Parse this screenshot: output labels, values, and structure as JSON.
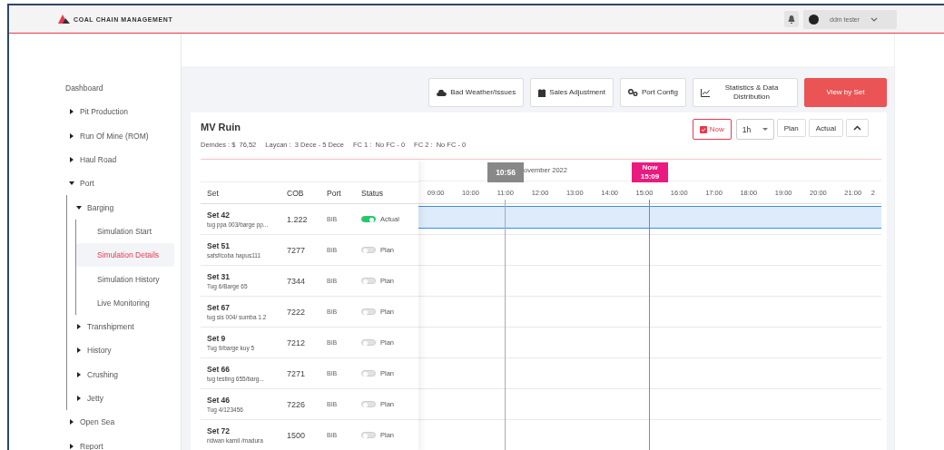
{
  "header": {
    "logo": "COAL CHAIN MANAGEMENT",
    "user": "ddm tester"
  },
  "sidebar": {
    "items": [
      {
        "label": "Dashboard",
        "selected": false
      },
      {
        "label": "Pit Production",
        "selected": false,
        "expanded": false
      },
      {
        "label": "Run Of Mine (ROM)",
        "selected": false,
        "expanded": false
      },
      {
        "label": "Haul Road",
        "selected": false,
        "expanded": false
      },
      {
        "label": "Port",
        "selected": false,
        "expanded": true,
        "children": [
          {
            "label": "Barging",
            "selected": false,
            "expanded": true,
            "children": [
              {
                "label": "Simulation Start",
                "selected": false
              },
              {
                "label": "Simulation Details",
                "selected": true
              },
              {
                "label": "Simulation History",
                "selected": false
              },
              {
                "label": "Live Monitoring",
                "selected": false
              }
            ]
          },
          {
            "label": "Transhipment",
            "selected": false,
            "expanded": false
          },
          {
            "label": "History",
            "selected": false,
            "expanded": false
          },
          {
            "label": "Crushing",
            "selected": false,
            "expanded": false
          },
          {
            "label": "Jetty",
            "selected": false,
            "expanded": false
          }
        ]
      },
      {
        "label": "Open Sea",
        "selected": false,
        "expanded": false
      },
      {
        "label": "Report",
        "selected": false,
        "expanded": false
      }
    ]
  },
  "toolbar": [
    {
      "label": "Bad Weather/Issues",
      "kind": "cloud"
    },
    {
      "label": "Sales Adjustment",
      "kind": "calendar"
    },
    {
      "label": "Port Config",
      "kind": "gears"
    },
    {
      "label": "Statistics & Data Distribution",
      "kind": "chart"
    },
    {
      "label": "View by Set",
      "kind": "primary"
    }
  ],
  "vessel": {
    "title": "MV Ruin",
    "info": [
      "Demdes : $  76,52",
      "Laycan :  3 Dece - 5 Dece",
      "FC 1 :  No FC - 0",
      "FC 2 :  No FC - 0"
    ]
  },
  "controls": {
    "now": "Now",
    "interval": "1h",
    "plan": "Plan",
    "actual": "Actual"
  },
  "timeline": {
    "date": "ovember 2022",
    "cursor": "10:56",
    "now_label": "Now",
    "now_time": "15:09",
    "hours": [
      "09:00",
      "10:00",
      "11:00",
      "12:00",
      "13:00",
      "14:00",
      "15:00",
      "16:00",
      "17:00",
      "18:00",
      "19:00",
      "20:00",
      "21:00",
      "2"
    ]
  },
  "table": {
    "columns": [
      "Set",
      "COB",
      "Port",
      "Status"
    ],
    "rows": [
      {
        "set": "Set 42",
        "sub": "tug ppa 003/barge pp...",
        "cob": "1.222",
        "port": "BIB",
        "on": true,
        "status": "Actual",
        "selected": true
      },
      {
        "set": "Set 51",
        "sub": "safsf/coba hapus111",
        "cob": "7277",
        "port": "BIB",
        "on": false,
        "status": "Plan",
        "selected": false
      },
      {
        "set": "Set 31",
        "sub": "Tug 6/Barge 65",
        "cob": "7344",
        "port": "BIB",
        "on": false,
        "status": "Plan",
        "selected": false
      },
      {
        "set": "Set 67",
        "sub": "tug sis 004/ sumba 1.2",
        "cob": "7222",
        "port": "BIB",
        "on": false,
        "status": "Plan",
        "selected": false
      },
      {
        "set": "Set 9",
        "sub": "Tug 9/barge kuy 5",
        "cob": "7212",
        "port": "BIB",
        "on": false,
        "status": "Plan",
        "selected": false
      },
      {
        "set": "Set 66",
        "sub": "tug testing 655/barg...",
        "cob": "7271",
        "port": "BIB",
        "on": false,
        "status": "Plan",
        "selected": false
      },
      {
        "set": "Set 46",
        "sub": "Tug 4/123456",
        "cob": "7226",
        "port": "BIB",
        "on": false,
        "status": "Plan",
        "selected": false
      },
      {
        "set": "Set 72",
        "sub": "ridwan kamil /madura",
        "cob": "1500",
        "port": "BIB",
        "on": false,
        "status": "Plan",
        "selected": false
      }
    ]
  }
}
